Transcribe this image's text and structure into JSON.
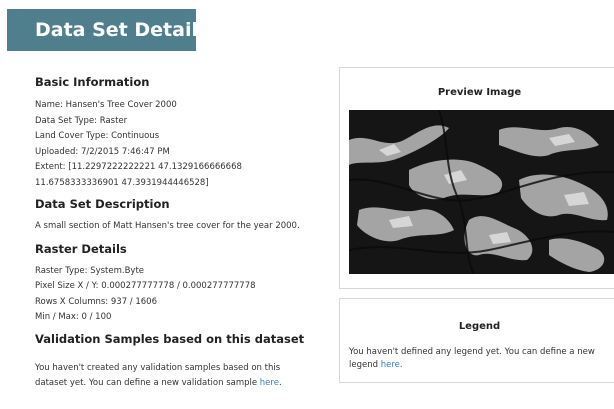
{
  "page": {
    "title": "Data Set Details"
  },
  "basic_info": {
    "heading": "Basic Information",
    "name": "Name: Hansen's Tree Cover 2000",
    "data_set_type": "Data Set Type: Raster",
    "land_cover_type": "Land Cover Type: Continuous",
    "uploaded": "Uploaded: 7/2/2015 7:46:47 PM",
    "extent_line1": "Extent: [11.2297222222221 47.1329166666668",
    "extent_line2": "11.6758333336901 47.3931944446528]"
  },
  "description": {
    "heading": "Data Set Description",
    "text": "A small section of Matt Hansen's tree cover for the year 2000."
  },
  "raster": {
    "heading": "Raster Details",
    "raster_type": "Raster Type: System.Byte",
    "pixel_size": "Pixel Size X / Y: 0.000277777778 / 0.000277777778",
    "rows_columns": "Rows X Columns: 937 / 1606",
    "min_max": "Min / Max: 0 / 100"
  },
  "validation": {
    "heading": "Validation Samples based on this dataset",
    "text_line1": "You haven't created any validation samples based on this",
    "text_line2_prefix": "dataset yet. You can define a new validation sample ",
    "link": "here",
    "text_line2_suffix": "."
  },
  "preview": {
    "title": "Preview Image"
  },
  "legend": {
    "title": "Legend",
    "text_prefix": "You haven't defined any legend yet. You can define a new legend ",
    "link": "here",
    "text_suffix": "."
  },
  "colors": {
    "banner": "#4f7f8d",
    "link": "#3a7fc2",
    "preview_dark": "#161616",
    "preview_light": "#c8c8c8"
  }
}
